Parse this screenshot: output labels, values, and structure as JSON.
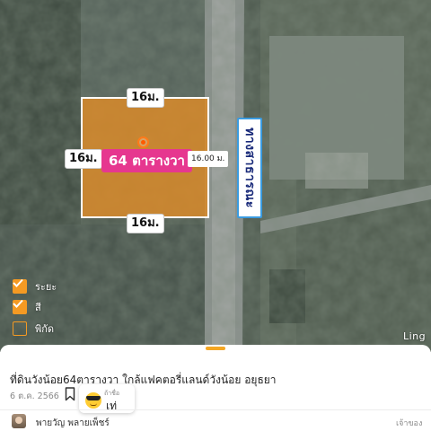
{
  "map": {
    "plot": {
      "width_label": "16ม.",
      "height_label": "16ม.",
      "bottom_label": "16ม.",
      "area_label": "64 ตารางวา",
      "scale_label": "16.00 ม."
    },
    "road_label": "ทางสาธารณะ",
    "watermark": "Ling",
    "legend": [
      {
        "label": "ระยะ",
        "checked": true
      },
      {
        "label": "สี",
        "checked": true
      },
      {
        "label": "พิกัด",
        "checked": false
      }
    ],
    "colors": {
      "plot_fill": "#d68a2c",
      "area_label_bg": "#e6378f",
      "road_label_border": "#3a9be0",
      "accent": "#f59a23"
    }
  },
  "listing": {
    "title": "ที่ดินวังน้อย64ตารางวา ใกล้แฟคตอรี่แลนด์วังน้อย อยุธยา",
    "date": "6 ต.ค. 2566",
    "bookmark_icon": "bookmark-icon",
    "reaction": {
      "icon": "cool-face-icon",
      "small_text": "ถ้าชื่อ",
      "label": "เท่"
    },
    "seller": {
      "name": "พายวัญ พลายเพ็ชร์",
      "role": "เจ้าของ"
    }
  }
}
